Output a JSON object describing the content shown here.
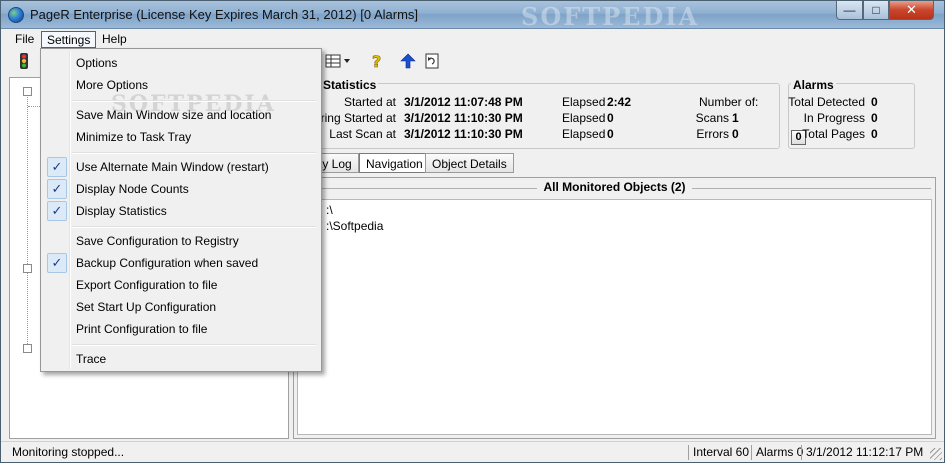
{
  "window": {
    "title": "PageR Enterprise (License Key Expires March 31, 2012) [0 Alarms]",
    "watermark": "SOFTPEDIA",
    "min_glyph": "—",
    "max_glyph": "□",
    "close_glyph": "✕"
  },
  "menubar": {
    "file": "File",
    "settings": "Settings",
    "help": "Help"
  },
  "settings_menu": {
    "options": "Options",
    "more_options": "More Options",
    "save_window": "Save Main Window size and location",
    "minimize_tray": "Minimize to Task Tray",
    "alt_window": "Use Alternate Main Window (restart)",
    "node_counts": "Display Node Counts",
    "statistics": "Display Statistics",
    "save_registry": "Save Configuration to Registry",
    "backup_config": "Backup Configuration when saved",
    "export_config": "Export Configuration to file",
    "startup_config": "Set Start Up Configuration",
    "print_config": "Print Configuration to file",
    "trace": "Trace",
    "check_glyph": "✓"
  },
  "statistics": {
    "legend": "Statistics",
    "started_at_label": "Started at",
    "started_at": "3/1/2012 11:07:48 PM",
    "monitoring_label": "toring Started at",
    "monitoring_started": "3/1/2012 11:10:30 PM",
    "last_scan_label": "Last Scan at",
    "last_scan": "3/1/2012 11:10:30 PM",
    "elapsed_label": "Elapsed",
    "elapsed_1": "2:42",
    "elapsed_2": "0",
    "elapsed_3": "0",
    "number_of_label": "Number of:",
    "scans_label": "Scans",
    "scans": "1",
    "errors_label": "Errors",
    "errors": "0"
  },
  "alarms": {
    "legend": "Alarms",
    "total_detected_label": "Total Detected",
    "total_detected": "0",
    "in_progress_label": "In Progress",
    "in_progress": "0",
    "total_pages_label": "Total Pages",
    "total_pages": "0",
    "reset_button": "0"
  },
  "tabs": {
    "activity_log": "ty Log",
    "navigation": "Navigation",
    "object_details": "Object Details"
  },
  "objects": {
    "header": "All Monitored Objects (2)",
    "rows": [
      ":\\",
      ":\\Softpedia"
    ]
  },
  "statusbar": {
    "status": "Monitoring stopped...",
    "interval": "Interval 60",
    "alarms": "Alarms 0",
    "timestamp": "3/1/2012 11:12:17 PM"
  },
  "colors": {
    "accent_check": "#1d3c8a",
    "titlebar": "#8fb0d2",
    "close_red": "#c9452b"
  }
}
